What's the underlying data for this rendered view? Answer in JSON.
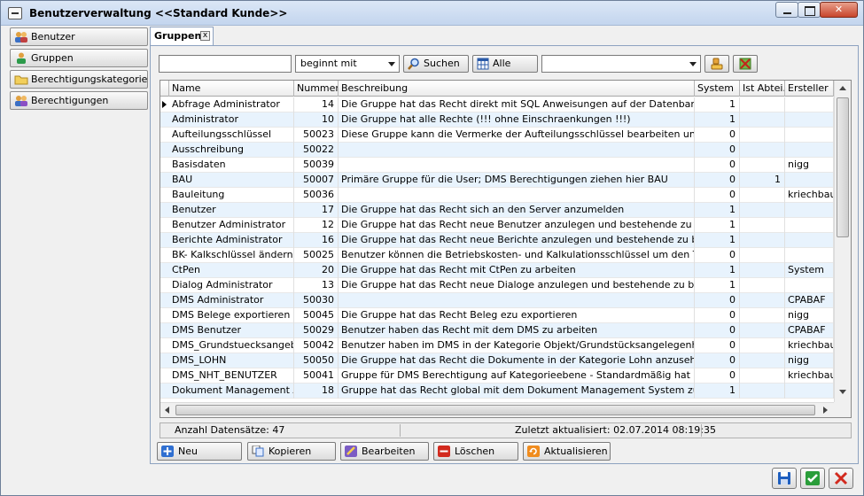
{
  "window": {
    "title": "Benutzerverwaltung  <<Standard Kunde>>"
  },
  "sidebar": {
    "items": [
      {
        "label": "Benutzer",
        "icon": "users-icon"
      },
      {
        "label": "Gruppen",
        "icon": "group-icon"
      },
      {
        "label": "Berechtigungskategorien",
        "icon": "folder-icon"
      },
      {
        "label": "Berechtigungen",
        "icon": "permissions-icon"
      }
    ]
  },
  "tab": {
    "label": "Gruppen",
    "close_glyph": "x"
  },
  "search": {
    "query_value": "",
    "mode_value": "beginnt mit",
    "search_label": "Suchen",
    "all_label": "Alle",
    "filter_value": ""
  },
  "grid": {
    "columns": [
      "Name",
      "Nummer",
      "Beschreibung",
      "System",
      "Ist Abtei...",
      "Ersteller"
    ],
    "rows": [
      [
        "Abfrage Administrator",
        "14",
        "Die Gruppe hat das Recht direkt mit SQL Anweisungen auf der Datenbank zu arbeiten",
        "1",
        "",
        ""
      ],
      [
        "Administrator",
        "10",
        "Die Gruppe hat alle Rechte (!!! ohne Einschraenkungen !!!)",
        "1",
        "",
        ""
      ],
      [
        "Aufteilungsschlüssel",
        "50023",
        "Diese Gruppe kann die Vermerke der Aufteilungsschlüssel bearbeiten und Anlegen",
        "0",
        "",
        ""
      ],
      [
        "Ausschreibung",
        "50022",
        "",
        "0",
        "",
        ""
      ],
      [
        "Basisdaten",
        "50039",
        "",
        "0",
        "",
        "nigg"
      ],
      [
        "BAU",
        "50007",
        "Primäre Gruppe für die User; DMS Berechtigungen ziehen hier    BAU",
        "0",
        "1",
        ""
      ],
      [
        "Bauleitung",
        "50036",
        "",
        "0",
        "",
        "kriechbaum"
      ],
      [
        "Benutzer",
        "17",
        "Die Gruppe hat das Recht sich an den Server anzumelden",
        "1",
        "",
        ""
      ],
      [
        "Benutzer Administrator",
        "12",
        "Die Gruppe hat das Recht neue Benutzer anzulegen und bestehende zu bearbeiten",
        "1",
        "",
        ""
      ],
      [
        "Berichte Administrator",
        "16",
        "Die Gruppe hat das Recht neue Berichte anzulegen und bestehende zu bearbeiten",
        "1",
        "",
        ""
      ],
      [
        "BK- Kalkschlüssel ändern",
        "50025",
        "Benutzer können die Betriebskosten- und Kalkulationsschlüssel um den Text erweitern",
        "0",
        "",
        ""
      ],
      [
        "CtPen",
        "20",
        "Die Gruppe hat das Recht mit CtPen zu arbeiten",
        "1",
        "",
        "System"
      ],
      [
        "Dialog Administrator",
        "13",
        "Die Gruppe hat das Recht neue Dialoge anzulegen und bestehende zu bearbeiten",
        "1",
        "",
        ""
      ],
      [
        "DMS Administrator",
        "50030",
        "",
        "0",
        "",
        "CPABAF"
      ],
      [
        "DMS Belege exportieren",
        "50045",
        "Die Gruppe hat das Recht Beleg ezu exportieren",
        "0",
        "",
        "nigg"
      ],
      [
        "DMS Benutzer",
        "50029",
        "Benutzer haben das Recht mit dem DMS zu arbeiten",
        "0",
        "",
        "CPABAF"
      ],
      [
        "DMS_Grundstuecksangebot",
        "50042",
        "Benutzer haben im DMS in der Kategorie  Objekt/Grundstücksangelegenheiten/Angebote",
        "0",
        "",
        "kriechbaum"
      ],
      [
        "DMS_LOHN",
        "50050",
        "Die Gruppe hat das Recht die Dokumente in der Kategorie Lohn anzusehen",
        "0",
        "",
        "nigg"
      ],
      [
        "DMS_NHT_BENUTZER",
        "50041",
        "Gruppe für DMS Berechtigung auf Kategorieebene - Standardmäßig hat diese Gruppe",
        "0",
        "",
        "kriechbaum"
      ],
      [
        "Dokument Management Adm",
        "18",
        "Gruppe hat das Recht global mit dem Dokument Management System zu arbeiten",
        "1",
        "",
        ""
      ]
    ]
  },
  "status": {
    "count_text": "Anzahl Datensätze: 47",
    "updated_text": "Zuletzt aktualisiert: 02.07.2014 08:19:35"
  },
  "actions": {
    "new_label": "Neu",
    "copy_label": "Kopieren",
    "edit_label": "Bearbeiten",
    "delete_label": "Löschen",
    "refresh_label": "Aktualisieren"
  },
  "colors": {
    "accent_blue": "#1f5fbf",
    "row_alt": "#e8f3fd",
    "ok_green": "#2a9d3a",
    "cancel_red": "#d22a1e"
  }
}
